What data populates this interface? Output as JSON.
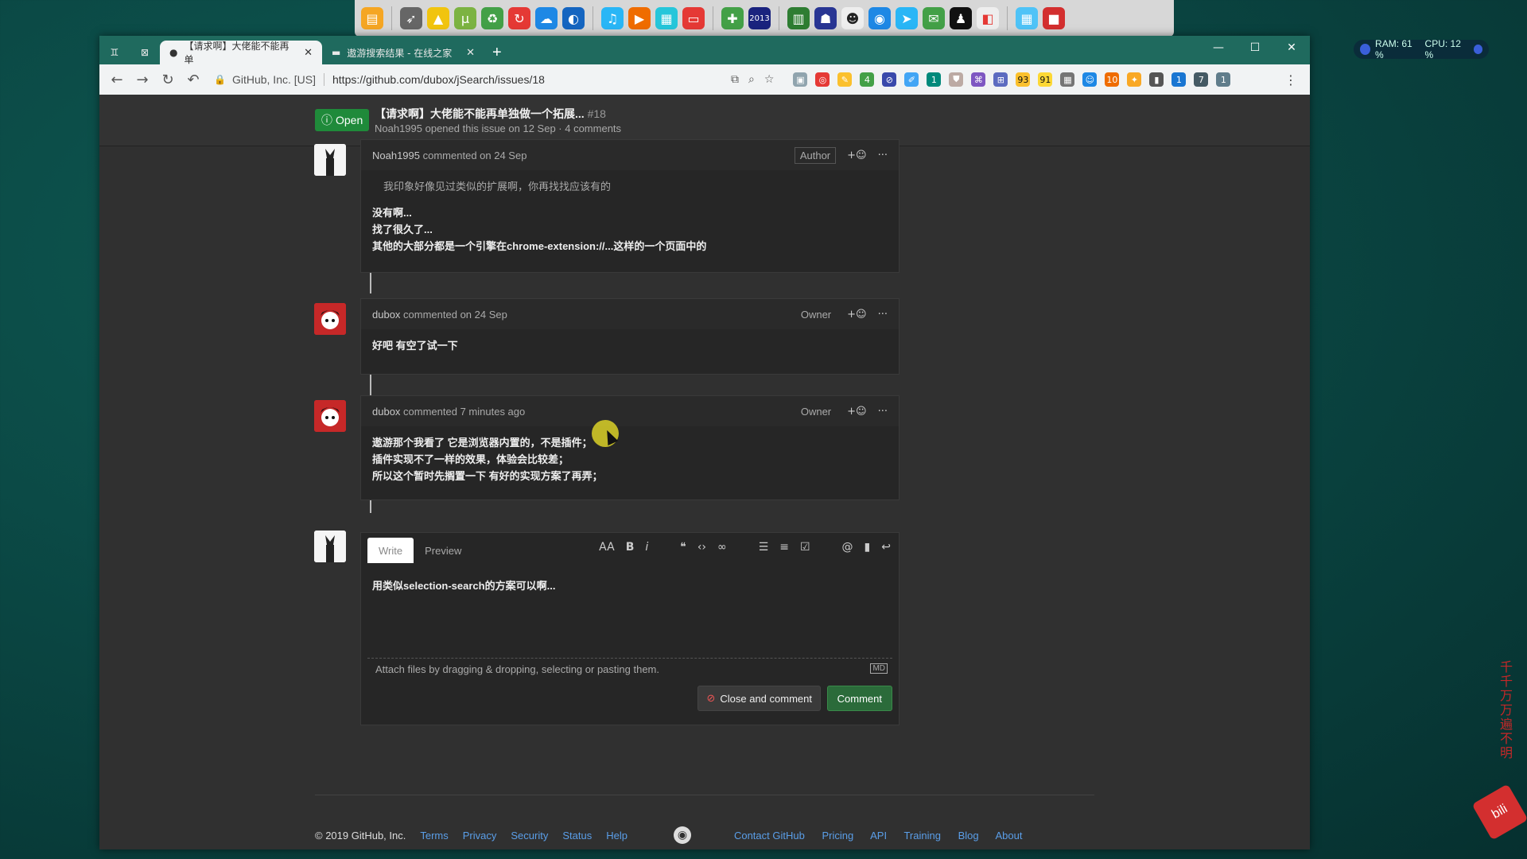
{
  "dock": {
    "icons": [
      "folder-icon",
      "rocket-icon",
      "drive-icon",
      "utorrent-icon",
      "recycle-icon",
      "refresh-icon",
      "cloud-icon",
      "browser-icon",
      "music-icon",
      "video-icon",
      "clapper-icon",
      "tv-icon",
      "gamepad-icon",
      "year-badge-icon",
      "grid-icon",
      "ghost-icon",
      "panda-icon",
      "chrome-icon",
      "telegram-icon",
      "wechat-icon",
      "qq-icon",
      "office-icon",
      "clapper-2-icon",
      "red-app-icon"
    ],
    "year_badge": "2013"
  },
  "sysmon": {
    "ram": "RAM: 61 %",
    "cpu": "CPU: 12 %"
  },
  "browser": {
    "tabs": [
      {
        "title": "【请求啊】大佬能不能再单",
        "active": true
      },
      {
        "title": "遨游搜索结果 - 在线之家",
        "active": false
      }
    ],
    "new_tab": "+",
    "omnibox": {
      "org": "GitHub, Inc. [US]",
      "url": "https://github.com/dubox/jSearch/issues/18"
    },
    "ext_badges": [
      "4",
      "1",
      "93",
      "91",
      "10",
      "1",
      "7",
      "1"
    ]
  },
  "issue": {
    "state": "Open",
    "title": "【请求啊】大佬能不能再单独做一个拓展...",
    "number": "#18",
    "subtitle": "Noah1995 opened this issue on 12 Sep · 4 comments"
  },
  "comments": [
    {
      "author": "Noah1995",
      "meta": "commented on 24 Sep",
      "role": "Author",
      "quote": "我印象好像见过类似的扩展啊，你再找找应该有的",
      "lines": [
        "没有啊...",
        "找了很久了...",
        "其他的大部分都是一个引擎在chrome-extension://...这样的一个页面中的"
      ]
    },
    {
      "author": "dubox",
      "meta": "commented on 24 Sep",
      "role": "Owner",
      "lines": [
        "好吧 有空了试一下"
      ]
    },
    {
      "author": "dubox",
      "meta": "commented 7 minutes ago",
      "role": "Owner",
      "lines": [
        "遨游那个我看了 它是浏览器内置的，不是插件；",
        "插件实现不了一样的效果，体验会比较差；",
        "所以这个暂时先搁置一下 有好的实现方案了再弄；"
      ]
    }
  ],
  "reaction_label": "+☺",
  "more_label": "···",
  "editor": {
    "tab_write": "Write",
    "tab_preview": "Preview",
    "text": "用类似selection-search的方案可以啊...",
    "attach": "Attach files by dragging & dropping, selecting or pasting them.",
    "md_badge": "MD",
    "close_btn": "Close and comment",
    "comment_btn": "Comment"
  },
  "footer": {
    "copyright": "© 2019 GitHub, Inc.",
    "left_links": [
      "Terms",
      "Privacy",
      "Security",
      "Status",
      "Help"
    ],
    "right_links": [
      "Contact GitHub",
      "Pricing",
      "API",
      "Training",
      "Blog",
      "About"
    ]
  },
  "watermark": {
    "text": "千千万万遍不明",
    "logo": "bili"
  },
  "colors": {
    "open_green": "#1f8a3a",
    "link_blue": "#5a9ee8",
    "comment_green": "#2b6b3a"
  }
}
